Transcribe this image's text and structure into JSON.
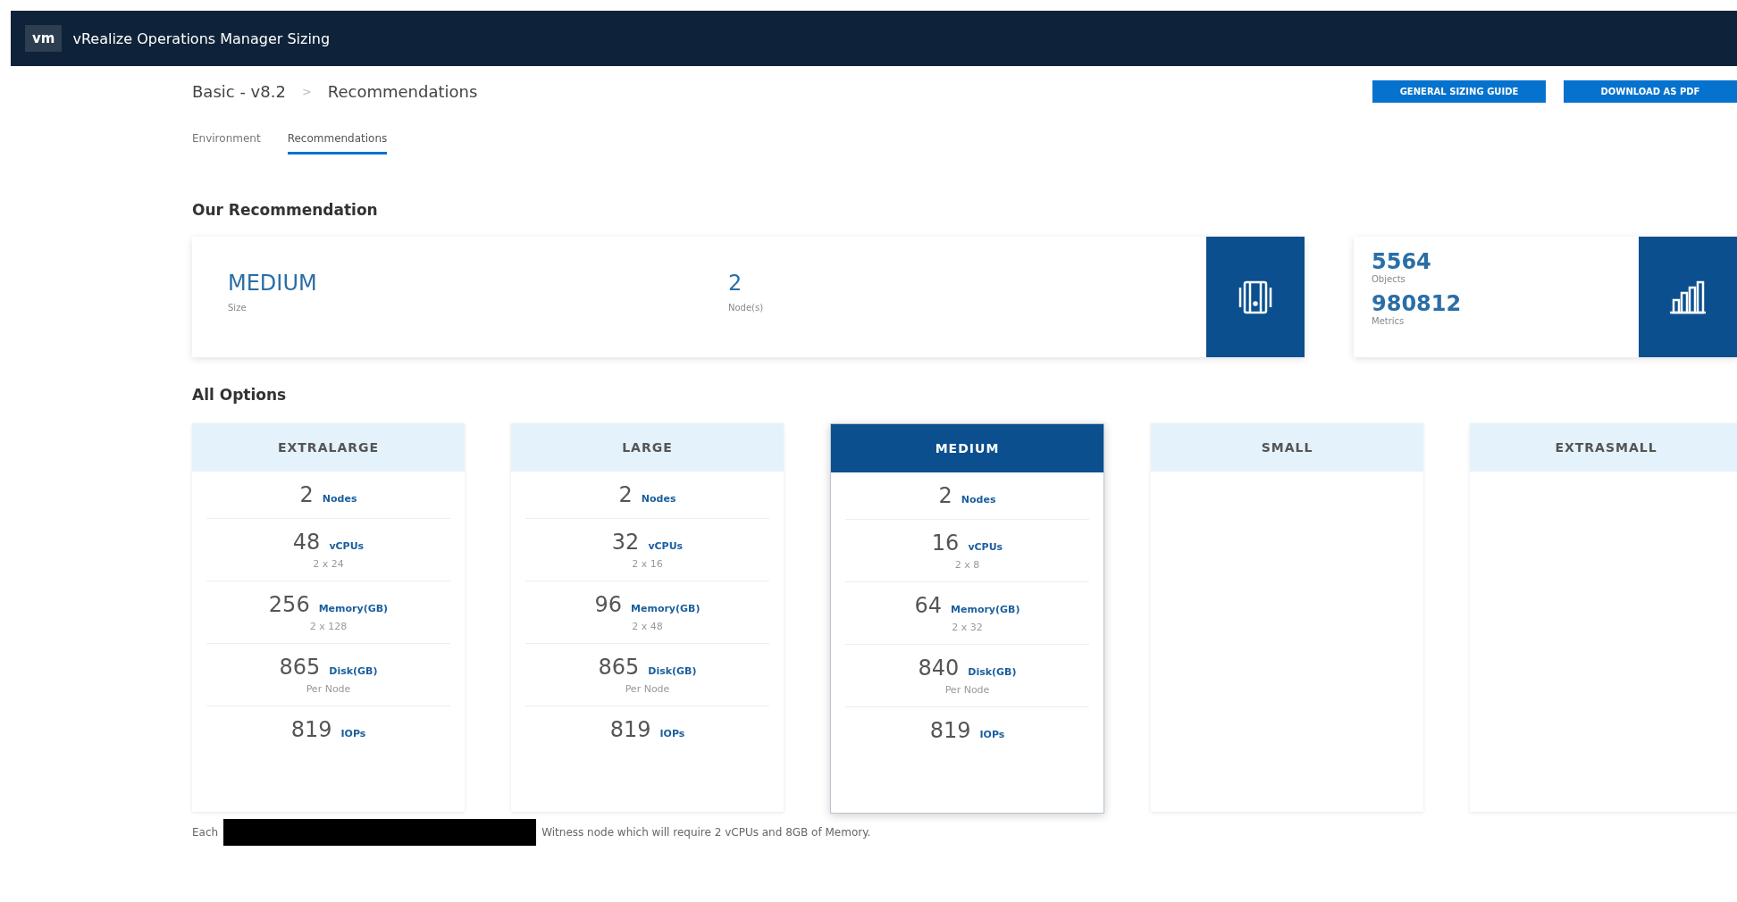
{
  "header": {
    "logo": "vm",
    "title": "vRealize Operations Manager Sizing"
  },
  "breadcrumb": {
    "items": [
      "Basic - v8.2",
      "Recommendations"
    ],
    "separator": ">"
  },
  "actions": [
    "GENERAL SIZING GUIDE",
    "DOWNLOAD AS PDF"
  ],
  "tabs": [
    {
      "label": "Environment",
      "selected": false
    },
    {
      "label": "Recommendations",
      "selected": true
    }
  ],
  "recommendation": {
    "heading": "Our Recommendation",
    "size": {
      "value": "MEDIUM",
      "label": "Size"
    },
    "nodes": {
      "value": "2",
      "label": "Node(s)"
    },
    "objects": {
      "value": "5564",
      "label": "Objects"
    },
    "metrics": {
      "value": "980812",
      "label": "Metrics"
    }
  },
  "options": {
    "heading": "All Options",
    "cards": [
      {
        "name": "EXTRALARGE",
        "selected": false,
        "rows": [
          {
            "value": "2",
            "unit": "Nodes"
          },
          {
            "value": "48",
            "unit": "vCPUs",
            "sub": "2 x 24"
          },
          {
            "value": "256",
            "unit": "Memory(GB)",
            "sub": "2 x 128"
          },
          {
            "value": "865",
            "unit": "Disk(GB)",
            "sub": "Per Node"
          },
          {
            "value": "819",
            "unit": "IOPs"
          }
        ]
      },
      {
        "name": "LARGE",
        "selected": false,
        "rows": [
          {
            "value": "2",
            "unit": "Nodes"
          },
          {
            "value": "32",
            "unit": "vCPUs",
            "sub": "2 x 16"
          },
          {
            "value": "96",
            "unit": "Memory(GB)",
            "sub": "2 x 48"
          },
          {
            "value": "865",
            "unit": "Disk(GB)",
            "sub": "Per Node"
          },
          {
            "value": "819",
            "unit": "IOPs"
          }
        ]
      },
      {
        "name": "MEDIUM",
        "selected": true,
        "rows": [
          {
            "value": "2",
            "unit": "Nodes"
          },
          {
            "value": "16",
            "unit": "vCPUs",
            "sub": "2 x 8"
          },
          {
            "value": "64",
            "unit": "Memory(GB)",
            "sub": "2 x 32"
          },
          {
            "value": "840",
            "unit": "Disk(GB)",
            "sub": "Per Node"
          },
          {
            "value": "819",
            "unit": "IOPs"
          }
        ]
      },
      {
        "name": "SMALL",
        "selected": false
      },
      {
        "name": "EXTRASMALL",
        "selected": false
      }
    ]
  },
  "footnote": {
    "lead": "Each",
    "text": "Witness node which will require 2 vCPUs and 8GB of Memory."
  }
}
